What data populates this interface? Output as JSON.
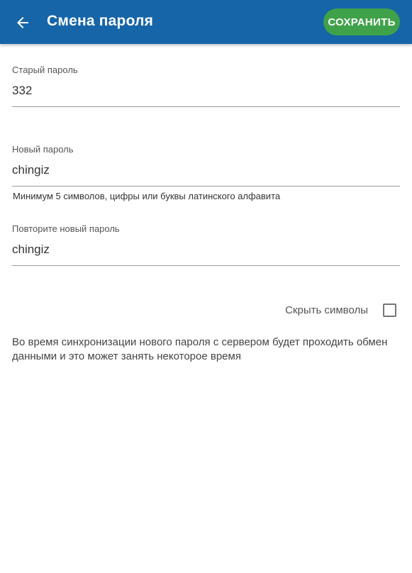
{
  "header": {
    "title": "Смена пароля",
    "save_label": "СОХРАНИТЬ",
    "back_icon": "arrow-left-icon"
  },
  "form": {
    "old_password": {
      "label": "Старый пароль",
      "value": "332"
    },
    "new_password": {
      "label": "Новый пароль",
      "value": "chingiz",
      "hint": "Минимум 5 символов, цифры или буквы латинского алфавита"
    },
    "repeat_password": {
      "label": "Повторите новый пароль",
      "value": "chingiz"
    },
    "hide_symbols": {
      "label": "Скрыть символы",
      "checked": false
    }
  },
  "info_text": "Во время синхронизации нового пароля с сервером будет проходить обмен данными и это может занять некоторое время",
  "colors": {
    "appbar": "#1565a8",
    "save_button": "#3fa24a"
  }
}
